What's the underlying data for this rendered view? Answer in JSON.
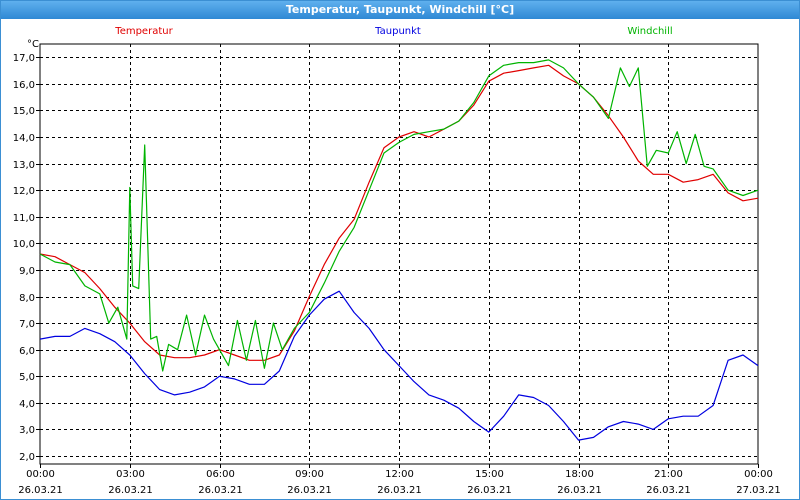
{
  "window": {
    "title": "Temperatur, Taupunkt, Windchill [°C]"
  },
  "chart_data": {
    "type": "line",
    "title": "Temperatur, Taupunkt, Windchill [°C]",
    "unit_label": "°C",
    "ylim": [
      1.7,
      17.5
    ],
    "y_ticks": [
      "2,0",
      "3,0",
      "4,0",
      "5,0",
      "6,0",
      "7,0",
      "8,0",
      "9,0",
      "10,0",
      "11,0",
      "12,0",
      "13,0",
      "14,0",
      "15,0",
      "16,0",
      "17,0"
    ],
    "y_tick_values": [
      2,
      3,
      4,
      5,
      6,
      7,
      8,
      9,
      10,
      11,
      12,
      13,
      14,
      15,
      16,
      17
    ],
    "x_range_hours": [
      0,
      24
    ],
    "x_ticks": [
      {
        "hour": 0,
        "time": "00:00",
        "date": "26.03.21"
      },
      {
        "hour": 3,
        "time": "03:00",
        "date": "26.03.21"
      },
      {
        "hour": 6,
        "time": "06:00",
        "date": "26.03.21"
      },
      {
        "hour": 9,
        "time": "09:00",
        "date": "26.03.21"
      },
      {
        "hour": 12,
        "time": "12:00",
        "date": "26.03.21"
      },
      {
        "hour": 15,
        "time": "15:00",
        "date": "26.03.21"
      },
      {
        "hour": 18,
        "time": "18:00",
        "date": "26.03.21"
      },
      {
        "hour": 21,
        "time": "21:00",
        "date": "26.03.21"
      },
      {
        "hour": 24,
        "time": "00:00",
        "date": "27.03.21"
      }
    ],
    "grid": true,
    "legend_position": "top",
    "series": [
      {
        "name": "Temperatur",
        "color": "#e00000",
        "x": [
          0,
          0.5,
          1,
          1.5,
          2,
          2.5,
          3,
          3.5,
          4,
          4.5,
          5,
          5.5,
          6,
          6.5,
          7,
          7.5,
          8,
          8.5,
          9,
          9.5,
          10,
          10.5,
          11,
          11.5,
          12,
          12.5,
          13,
          13.5,
          14,
          14.5,
          15,
          15.5,
          16,
          16.5,
          17,
          17.5,
          18,
          18.5,
          19,
          19.5,
          20,
          20.5,
          21,
          21.5,
          22,
          22.5,
          23,
          23.5,
          24
        ],
        "y": [
          9.6,
          9.5,
          9.2,
          8.9,
          8.3,
          7.6,
          7.0,
          6.3,
          5.8,
          5.7,
          5.7,
          5.8,
          6.0,
          5.8,
          5.6,
          5.6,
          5.8,
          6.7,
          8.0,
          9.2,
          10.2,
          10.9,
          12.3,
          13.6,
          14.0,
          14.2,
          14.0,
          14.3,
          14.6,
          15.2,
          16.1,
          16.4,
          16.5,
          16.6,
          16.7,
          16.3,
          16.0,
          15.5,
          14.8,
          14.0,
          13.1,
          12.6,
          12.6,
          12.3,
          12.4,
          12.6,
          11.9,
          11.6,
          11.7
        ]
      },
      {
        "name": "Taupunkt",
        "color": "#0000e0",
        "x": [
          0,
          0.5,
          1,
          1.5,
          2,
          2.5,
          3,
          3.5,
          4,
          4.5,
          5,
          5.5,
          6,
          6.5,
          7,
          7.5,
          8,
          8.5,
          9,
          9.5,
          10,
          10.5,
          11,
          11.5,
          12,
          12.5,
          13,
          13.5,
          14,
          14.5,
          15,
          15.5,
          16,
          16.5,
          17,
          17.5,
          18,
          18.5,
          19,
          19.5,
          20,
          20.5,
          21,
          21.5,
          22,
          22.5,
          23,
          23.5,
          24
        ],
        "y": [
          6.4,
          6.5,
          6.5,
          6.8,
          6.6,
          6.3,
          5.8,
          5.1,
          4.5,
          4.3,
          4.4,
          4.6,
          5.0,
          4.9,
          4.7,
          4.7,
          5.2,
          6.5,
          7.3,
          7.9,
          8.2,
          7.4,
          6.8,
          6.0,
          5.4,
          4.8,
          4.3,
          4.1,
          3.8,
          3.3,
          2.9,
          3.5,
          4.3,
          4.2,
          3.9,
          3.3,
          2.6,
          2.7,
          3.1,
          3.3,
          3.2,
          3.0,
          3.4,
          3.5,
          3.5,
          3.9,
          5.6,
          5.8,
          5.4
        ]
      },
      {
        "name": "Windchill",
        "color": "#00b400",
        "x": [
          0,
          0.5,
          1,
          1.5,
          2,
          2.3,
          2.6,
          2.9,
          3.0,
          3.1,
          3.3,
          3.5,
          3.7,
          3.9,
          4.1,
          4.3,
          4.6,
          4.9,
          5.2,
          5.5,
          5.8,
          6.0,
          6.3,
          6.6,
          6.9,
          7.2,
          7.5,
          7.8,
          8.1,
          8.5,
          9,
          9.5,
          10,
          10.5,
          11,
          11.5,
          12,
          12.5,
          13,
          13.5,
          14,
          14.5,
          15,
          15.5,
          16,
          16.5,
          17,
          17.5,
          18,
          18.5,
          19,
          19.4,
          19.7,
          20,
          20.3,
          20.6,
          21,
          21.3,
          21.6,
          21.9,
          22.2,
          22.5,
          23,
          23.5,
          24
        ],
        "y": [
          9.6,
          9.3,
          9.2,
          8.4,
          8.1,
          7.0,
          7.6,
          6.4,
          12.1,
          8.4,
          8.3,
          13.7,
          6.4,
          6.5,
          5.2,
          6.2,
          6.0,
          7.3,
          5.8,
          7.3,
          6.4,
          6.0,
          5.4,
          7.1,
          5.6,
          7.1,
          5.3,
          7.0,
          6.0,
          6.8,
          7.4,
          8.5,
          9.7,
          10.6,
          12.0,
          13.4,
          13.8,
          14.1,
          14.2,
          14.3,
          14.6,
          15.3,
          16.3,
          16.7,
          16.8,
          16.8,
          16.9,
          16.6,
          16.0,
          15.5,
          14.7,
          16.6,
          15.9,
          16.6,
          12.9,
          13.5,
          13.4,
          14.2,
          13.0,
          14.1,
          12.9,
          12.8,
          12.0,
          11.8,
          12.0
        ]
      }
    ]
  }
}
